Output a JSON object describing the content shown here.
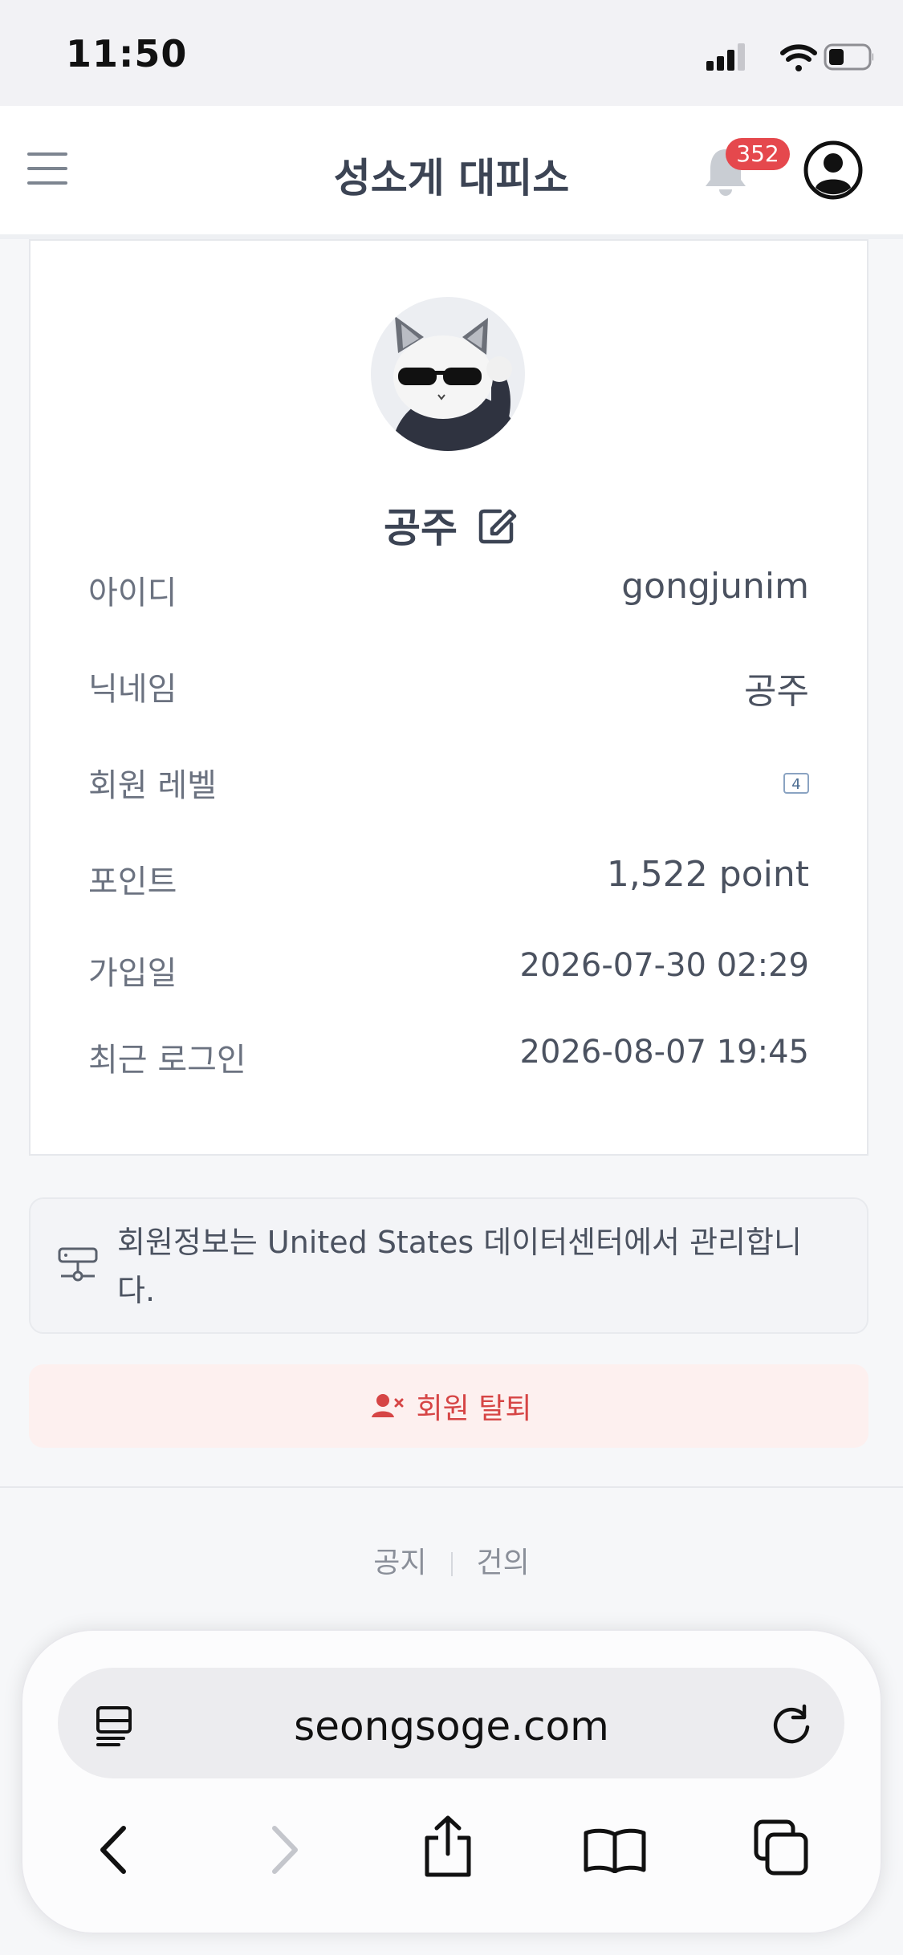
{
  "status_bar": {
    "time": "11:50"
  },
  "header": {
    "title": "성소게 대피소",
    "notification_count": "352"
  },
  "profile": {
    "nickname": "공주",
    "rows": [
      {
        "label": "아이디",
        "value": "gongjunim"
      },
      {
        "label": "닉네임",
        "value": "공주"
      },
      {
        "label": "회원 레벨",
        "value": "4"
      },
      {
        "label": "포인트",
        "value": "1,522 point"
      },
      {
        "label": "가입일",
        "value": "2026-07-30 02:29"
      },
      {
        "label": "최근 로그인",
        "value": "2026-08-07 19:45"
      }
    ]
  },
  "notice": {
    "text": "회원정보는 United States 데이터센터에서 관리합니다."
  },
  "withdraw": {
    "label": "회원 탈퇴"
  },
  "footer": {
    "links": [
      "공지",
      "건의"
    ]
  },
  "browser": {
    "url": "seongsoge.com"
  },
  "icons": [
    "menu-icon",
    "bell-icon",
    "user-circle-icon",
    "edit-icon",
    "server-icon",
    "user-remove-icon",
    "reader-icon",
    "reload-icon",
    "back-icon",
    "forward-icon",
    "share-icon",
    "bookmarks-icon",
    "tabs-icon"
  ],
  "colors": {
    "accent_red": "#e5484d",
    "withdraw_text": "#d64545",
    "title": "#3c4454"
  }
}
